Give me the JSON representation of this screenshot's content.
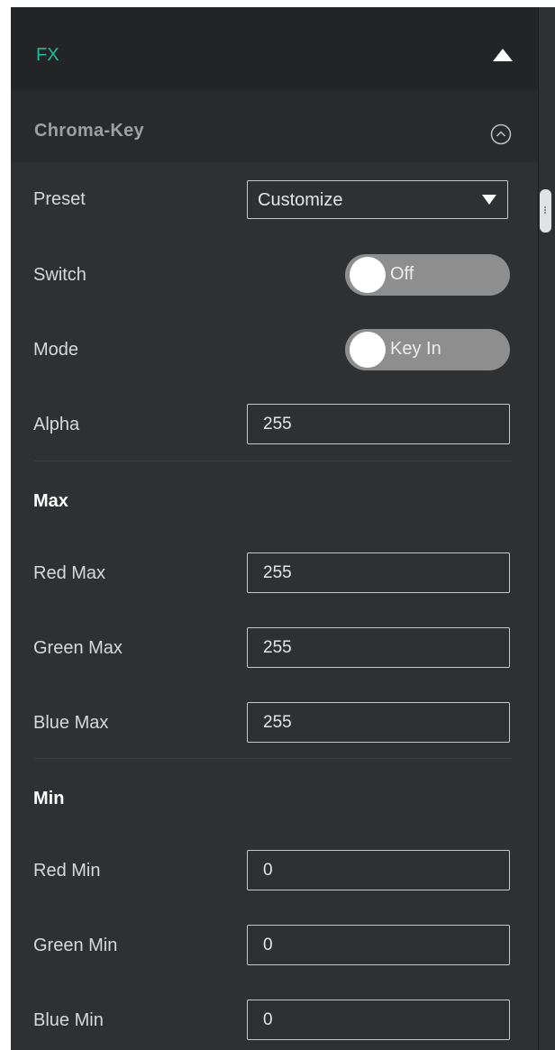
{
  "fx": {
    "title": "FX"
  },
  "section": {
    "title": "Chroma-Key"
  },
  "preset": {
    "label": "Preset",
    "value": "Customize"
  },
  "switch": {
    "label": "Switch",
    "state": "Off"
  },
  "mode": {
    "label": "Mode",
    "state": "Key In"
  },
  "alpha": {
    "label": "Alpha",
    "value": "255"
  },
  "max": {
    "heading": "Max",
    "red": {
      "label": "Red Max",
      "value": "255"
    },
    "green": {
      "label": "Green Max",
      "value": "255"
    },
    "blue": {
      "label": "Blue Max",
      "value": "255"
    }
  },
  "min": {
    "heading": "Min",
    "red": {
      "label": "Red Min",
      "value": "0"
    },
    "green": {
      "label": "Green Min",
      "value": "0"
    },
    "blue": {
      "label": "Blue Min",
      "value": "0"
    }
  },
  "colors": {
    "accent": "#22b99a",
    "panel": "#2e3032",
    "header": "#232426",
    "toggle_track": "#8e8e8e"
  },
  "icons": {
    "fx_collapse": "triangle-up-icon",
    "chroma_collapse": "chevron-up-circle-icon",
    "select_caret": "caret-down-icon"
  }
}
